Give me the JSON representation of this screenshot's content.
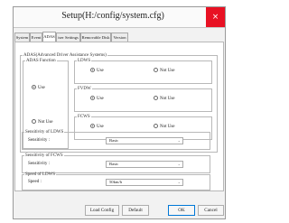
{
  "window": {
    "title": "Setup(H:/config/system.cfg)",
    "close_glyph": "×"
  },
  "tabs": [
    "System",
    "Event",
    "ADAS",
    "iser Settings",
    "Removable Disk",
    "Version"
  ],
  "active_tab": "ADAS",
  "adas": {
    "legend": "ADAS(Advanced Driver Assistance Systems)",
    "function": {
      "legend": "ADAS Function",
      "use": "Use",
      "not_use": "Not Use",
      "selected": "Use"
    },
    "ldws": {
      "legend": "LDWS",
      "use": "Use",
      "not_use": "Not Use",
      "selected": "Use"
    },
    "fvdw": {
      "legend": "FVDW",
      "use": "Use",
      "not_use": "Not Use",
      "selected": "Use"
    },
    "fcws": {
      "legend": "FCWS",
      "use": "Use",
      "not_use": "Not Use",
      "selected": "Use"
    }
  },
  "sensitivity_ldws": {
    "legend": "Sensitivity of LDWS",
    "label": "Sensitivity :",
    "value": "Basic"
  },
  "sensitivity_fcws": {
    "legend": "Sensitivity of FCWS",
    "label": "Sensitivity :",
    "value": "Basic"
  },
  "speed_ldws": {
    "legend": "Speed of LDWS",
    "label": "Speed :",
    "value": "50km/h"
  },
  "buttons": {
    "load_config": "Load Config",
    "default": "Default",
    "ok": "OK",
    "cancel": "Cancel"
  },
  "icons": {
    "close": "close-icon",
    "dropdown": "chevron-down-icon"
  }
}
